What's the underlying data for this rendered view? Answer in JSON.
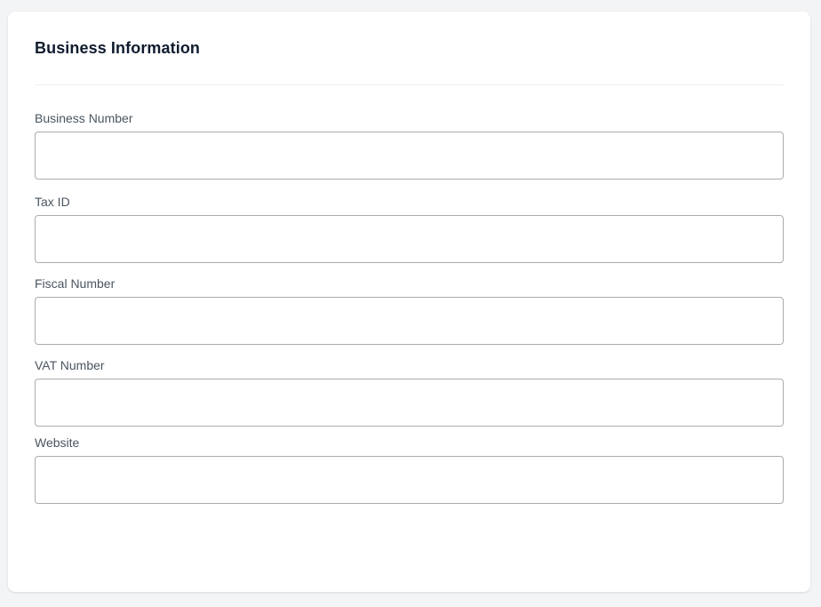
{
  "section": {
    "title": "Business Information"
  },
  "fields": {
    "business_number": {
      "label": "Business Number",
      "value": "",
      "placeholder": ""
    },
    "tax_id": {
      "label": "Tax ID",
      "value": "",
      "placeholder": ""
    },
    "fiscal_number": {
      "label": "Fiscal Number",
      "value": "",
      "placeholder": ""
    },
    "vat_number": {
      "label": "VAT Number",
      "value": "",
      "placeholder": ""
    },
    "website": {
      "label": "Website",
      "value": "",
      "placeholder": ""
    }
  },
  "colors": {
    "page_background": "#f3f4f6",
    "card_background": "#ffffff",
    "title_text": "#0f1c2e",
    "label_text": "#4a5560",
    "input_border": "#a9acb0"
  }
}
